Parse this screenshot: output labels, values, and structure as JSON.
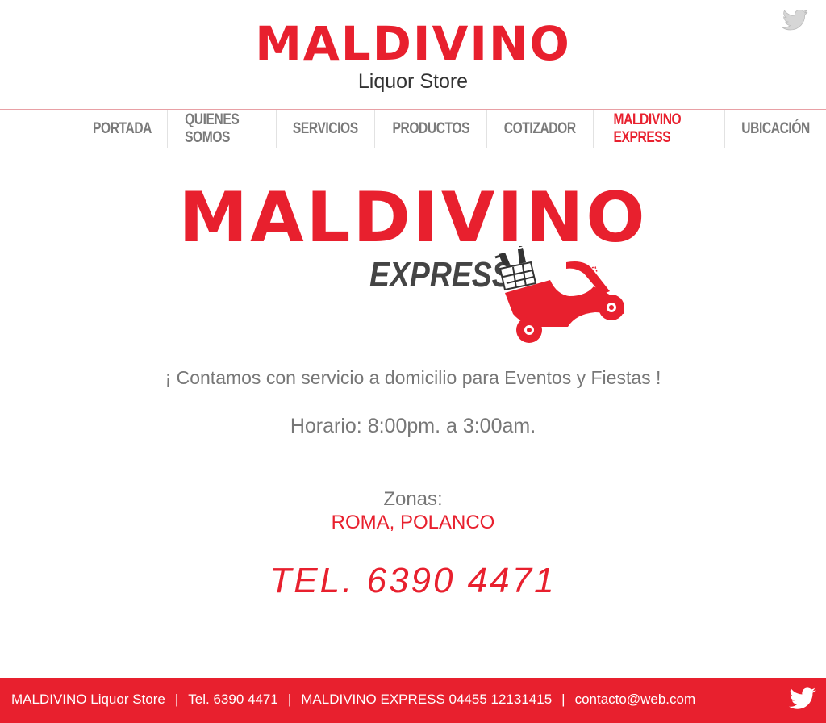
{
  "header": {
    "brand": "MALDIVINO",
    "subtitle": "Liquor Store",
    "twitter_icon": "twitter-icon"
  },
  "nav": {
    "items": [
      {
        "label": "PORTADA",
        "active": false
      },
      {
        "label": "QUIENES SOMOS",
        "active": false
      },
      {
        "label": "SERVICIOS",
        "active": false
      },
      {
        "label": "PRODUCTOS",
        "active": false
      },
      {
        "label": "COTIZADOR",
        "active": false
      },
      {
        "label": "MALDIVINO EXPRESS",
        "active": true
      },
      {
        "label": "UBICACIÓN",
        "active": false
      }
    ]
  },
  "express_logo": {
    "title": "MALDIVINO",
    "subtitle": "EXPRESS",
    "icon": "delivery-scooter-icon"
  },
  "content": {
    "tagline": "¡ Contamos con servicio a domicilio para Eventos y Fiestas !",
    "hours": "Horario: 8:00pm. a 3:00am.",
    "zones_label": "Zonas:",
    "zones": "ROMA, POLANCO",
    "phone": "TEL. 6390 4471"
  },
  "footer": {
    "store": "MALDIVINO Liquor Store",
    "tel": "Tel. 6390 4471",
    "express": "MALDIVINO EXPRESS  04455 12131415",
    "email": "contacto@web.com",
    "separator": "|"
  },
  "colors": {
    "brand_red": "#e8202e",
    "text_gray": "#777777",
    "nav_gray": "#7a7a7a"
  }
}
